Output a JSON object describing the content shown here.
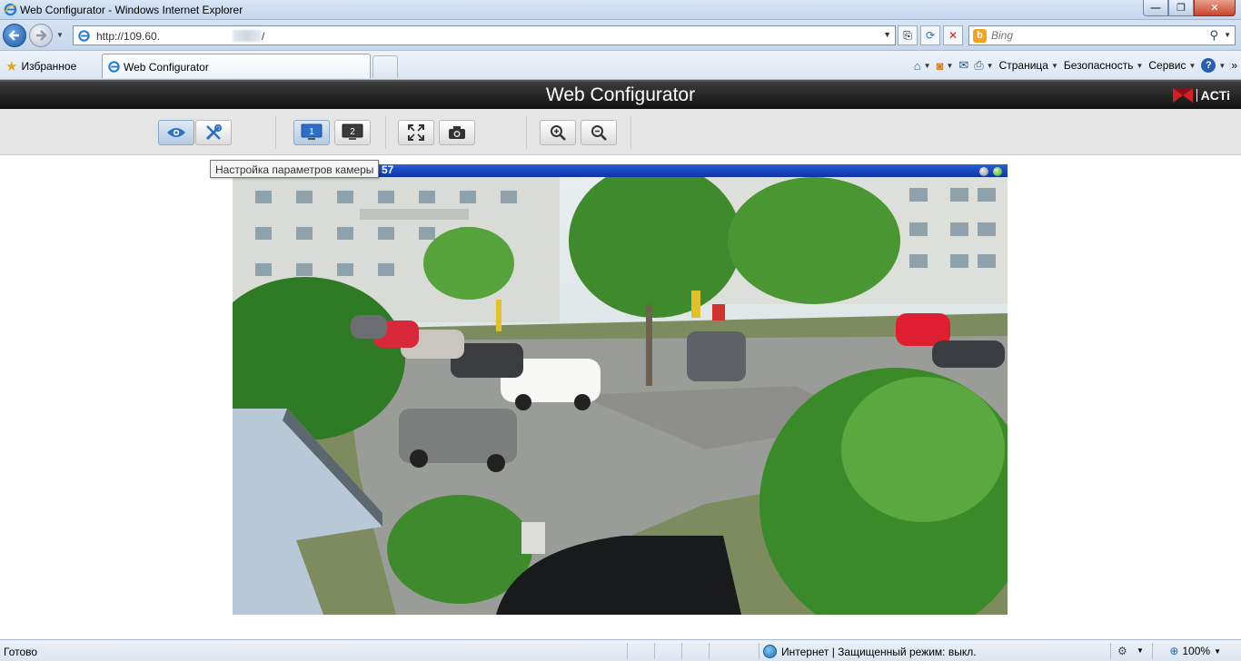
{
  "window": {
    "title": "Web Configurator - Windows Internet Explorer",
    "minimize": "—",
    "restore": "❐",
    "close": "✕"
  },
  "address": {
    "url_start": "http://109.60.",
    "url_end": "/",
    "dropdown": "▼",
    "compat": "⎘",
    "refresh": "⟳",
    "stop": "✕"
  },
  "search": {
    "placeholder": "Bing",
    "logo": "b",
    "go": "⚲",
    "dropdown": "▼"
  },
  "favorites": {
    "label": "Избранное"
  },
  "tab": {
    "title": "Web Configurator"
  },
  "commands": {
    "page": "Страница",
    "safety": "Безопасность",
    "tools": "Сервис",
    "help": "?",
    "more": "»"
  },
  "page": {
    "title": "Web Configurator",
    "logo_text": "ACTi",
    "toolbar": {
      "live_view": "eye-icon",
      "setup": "wrench-icon",
      "channel_1": "1",
      "channel_2": "2",
      "fullscreen": "fullscreen-icon",
      "snapshot": "camera-icon",
      "zoom_in": "zoom-in-icon",
      "zoom_out": "zoom-out-icon"
    },
    "tooltip": "Настройка параметров камеры",
    "video": {
      "timestamp": "57"
    }
  },
  "status": {
    "ready": "Готово",
    "zone": "Интернет | Защищенный режим: выкл.",
    "zoom": "100%"
  },
  "colors": {
    "video_bar": "#0b34a5",
    "header_bg": "#1a1a1a",
    "toolbar_bg": "#e5e5e5"
  }
}
